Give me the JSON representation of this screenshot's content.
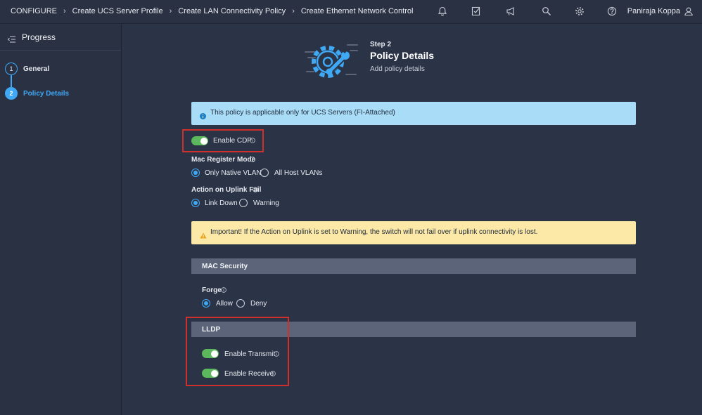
{
  "breadcrumbs": [
    "CONFIGURE",
    "Create UCS Server Profile",
    "Create LAN Connectivity Policy",
    "Create Ethernet Network Control"
  ],
  "topbar_icons": [
    "bell-icon",
    "checklist-icon",
    "megaphone-icon",
    "search-icon",
    "gear-icon",
    "help-icon"
  ],
  "user": {
    "name": "Paniraja Koppa",
    "icon": "user-icon"
  },
  "sidebar": {
    "title": "Progress",
    "steps": [
      {
        "number": "1",
        "label": "General",
        "state": "completed"
      },
      {
        "number": "2",
        "label": "Policy Details",
        "state": "active"
      }
    ]
  },
  "header": {
    "step": "Step 2",
    "title": "Policy Details",
    "subtitle": "Add policy details"
  },
  "info_banner": "This policy is applicable only for UCS Servers (FI-Attached)",
  "enable_cdp": {
    "label": "Enable CDP",
    "enabled": true
  },
  "mac_register_mode": {
    "label": "Mac Register Mode",
    "options": [
      "Only Native VLAN",
      "All Host VLANs"
    ],
    "selected": "Only Native VLAN"
  },
  "action_on_uplink_fail": {
    "label": "Action on Uplink Fail",
    "options": [
      "Link Down",
      "Warning"
    ],
    "selected": "Link Down"
  },
  "warning_banner": "Important! If the Action on Uplink is set to Warning, the switch will not fail over if uplink connectivity is lost.",
  "mac_security": {
    "title": "MAC Security",
    "forge": {
      "label": "Forge",
      "options": [
        "Allow",
        "Deny"
      ],
      "selected": "Allow"
    }
  },
  "lldp": {
    "title": "LLDP",
    "enable_transmit": {
      "label": "Enable Transmit",
      "enabled": true
    },
    "enable_receive": {
      "label": "Enable Receive",
      "enabled": true
    }
  },
  "colors": {
    "accent": "#3fa9f5",
    "toggle_on": "#5cb85c",
    "highlight": "#d0302b",
    "info_bg": "#a9dcf7",
    "warning_bg": "#fce9a8"
  }
}
